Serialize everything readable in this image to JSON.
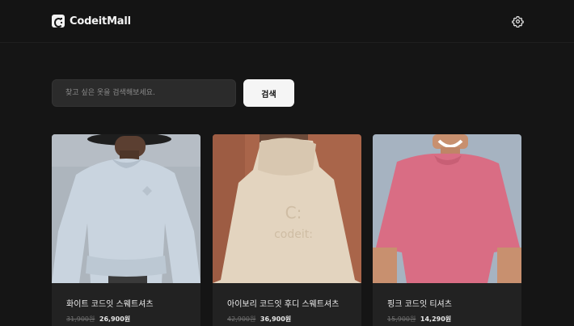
{
  "header": {
    "brand": "CodeitMall",
    "settings_icon": "gear-icon"
  },
  "search": {
    "placeholder": "찾고 싶은 옷을 검색해보세요.",
    "button_label": "검색"
  },
  "products": [
    {
      "name": "화이트 코드잇 스웨트셔츠",
      "original_price": "31,900원",
      "sale_price": "26,900원",
      "image_bg": "#adb5bd"
    },
    {
      "name": "아이보리 코드잇 후디 스웨트셔츠",
      "original_price": "42,900원",
      "sale_price": "36,900원",
      "image_bg": "#a9654a"
    },
    {
      "name": "핑크 코드잇 티셔츠",
      "original_price": "15,900원",
      "sale_price": "14,290원",
      "image_bg": "#a6b3c1"
    }
  ],
  "colors": {
    "background": "#151515",
    "card": "#222222",
    "input": "#2b2b2b",
    "button": "#f5f5f5"
  }
}
